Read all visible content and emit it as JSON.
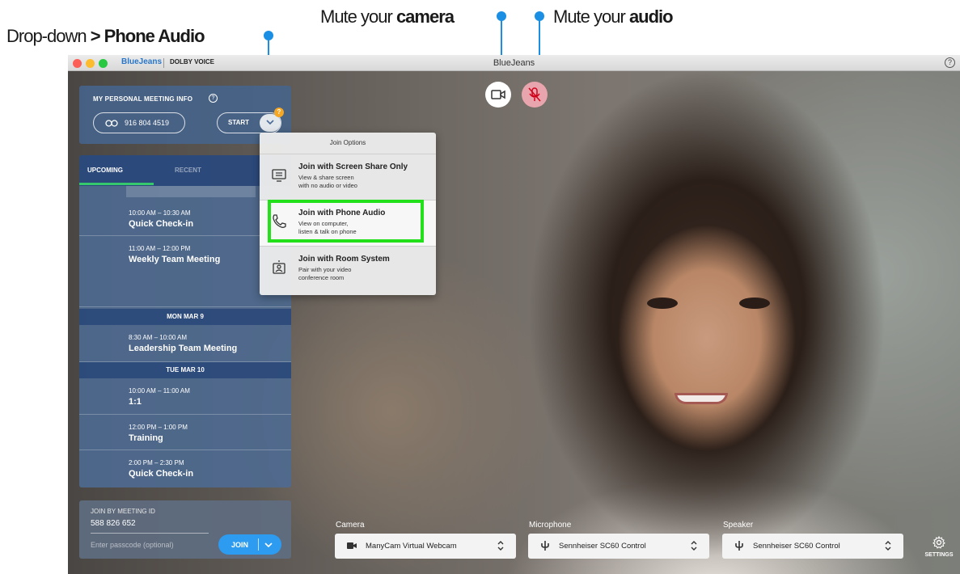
{
  "annotations": {
    "dropdown": {
      "prefix": "Drop-down ",
      "bold": "> Phone Audio"
    },
    "camera": {
      "prefix": "Mute your ",
      "bold": "camera"
    },
    "audio": {
      "prefix": "Mute your ",
      "bold": "audio"
    }
  },
  "window": {
    "brand": "BlueJeans",
    "brand_partner": "DOLBY VOICE",
    "title": "BlueJeans",
    "help_glyph": "?"
  },
  "colors": {
    "accent": "#1a8fe3",
    "highlight": "#22e01a",
    "join_button": "#2d9bf0",
    "tab_underline": "#35c86d",
    "badge": "#f5a623"
  },
  "meeting_info": {
    "title": "MY PERSONAL MEETING INFO",
    "phone": "916 804 4519",
    "start_label": "START",
    "badge": "?"
  },
  "tabs": {
    "upcoming": "UPCOMING",
    "recent": "RECENT"
  },
  "meetings": {
    "today": [
      {
        "time": "10:00 AM – 10:30 AM",
        "name": "Quick Check-in"
      },
      {
        "time": "11:00 AM – 12:00 PM",
        "name": "Weekly Team Meeting"
      }
    ],
    "day1": {
      "header": "MON MAR 9",
      "items": [
        {
          "time": "8:30 AM – 10:00 AM",
          "name": "Leadership Team Meeting"
        }
      ]
    },
    "day2": {
      "header": "TUE MAR 10",
      "items": [
        {
          "time": "10:00 AM – 11:00 AM",
          "name": "1:1"
        },
        {
          "time": "12:00 PM – 1:00 PM",
          "name": "Training"
        },
        {
          "time": "2:00 PM – 2:30 PM",
          "name": "Quick Check-in"
        }
      ]
    }
  },
  "join": {
    "label": "JOIN BY MEETING ID",
    "meeting_id": "588 826 652",
    "passcode_placeholder": "Enter passcode (optional)",
    "button": "JOIN"
  },
  "join_options": {
    "title": "Join Options",
    "items": [
      {
        "title": "Join with Screen Share Only",
        "desc1": "View & share screen",
        "desc2": "with no audio or video",
        "icon": "screen-share-icon"
      },
      {
        "title": "Join with Phone Audio",
        "desc1": "View on computer,",
        "desc2": "listen & talk on phone",
        "icon": "phone-icon"
      },
      {
        "title": "Join with Room System",
        "desc1": "Pair with your video",
        "desc2": "conference room",
        "icon": "room-system-icon"
      }
    ]
  },
  "devices": {
    "camera": {
      "label": "Camera",
      "value": "ManyCam Virtual Webcam"
    },
    "microphone": {
      "label": "Microphone",
      "value": "Sennheiser SC60 Control"
    },
    "speaker": {
      "label": "Speaker",
      "value": "Sennheiser SC60 Control"
    }
  },
  "settings_label": "SETTINGS"
}
